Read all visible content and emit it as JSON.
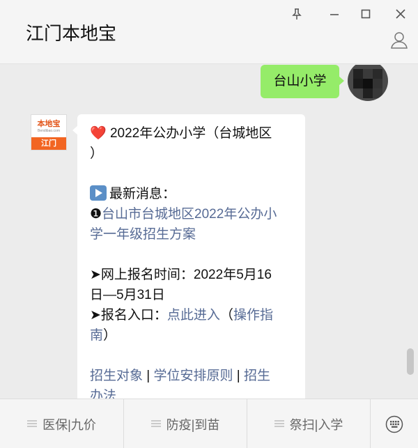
{
  "window": {
    "title": "江门本地宝",
    "controls": [
      "pin-icon",
      "minimize-icon",
      "maximize-icon",
      "close-icon"
    ],
    "profile_icon": "person-icon"
  },
  "chat": {
    "outgoing": {
      "text": "台山小学"
    },
    "incoming": {
      "sender_logo": {
        "name": "本地宝",
        "url": "Bendibao.com",
        "city": "江门"
      },
      "line1": "2022年公办小学（台城地区",
      "line2": "）",
      "news_label": "最新消息：",
      "news_bullet": "❶",
      "news_link_1": "台山市台城地区2022年公办小",
      "news_link_2": "学一年级招生方案",
      "reg_time_label": "➤网上报名时间：2022年5月16",
      "reg_time_value": "日—5月31日",
      "entry_label": "➤报名入口：",
      "entry_link": "点此进入",
      "guide_open": "（",
      "guide_link_1": "操作指",
      "guide_link_2": "南",
      "guide_close": "）",
      "link_targets": "招生对象",
      "sep": " | ",
      "link_principles": "学位安排原则",
      "link_methods_1": "招生",
      "link_methods_2": "办法"
    }
  },
  "menu": {
    "items": [
      {
        "label": "医保|九价",
        "icon": "menu-lines-icon"
      },
      {
        "label": "防疫|到苗",
        "icon": "menu-lines-icon"
      },
      {
        "label": "祭扫|入学",
        "icon": "menu-lines-icon"
      }
    ],
    "keyboard_icon": "keyboard-icon"
  },
  "colors": {
    "outgoing_bubble": "#95ec69",
    "link": "#576b95",
    "brand_orange": "#f26522"
  }
}
